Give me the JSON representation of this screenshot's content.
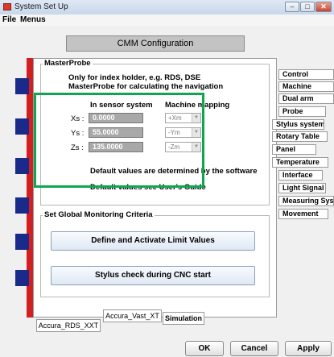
{
  "window": {
    "title": "System Set Up",
    "minimize": "–",
    "maximize": "□",
    "close": "✕"
  },
  "menu": {
    "file": "File",
    "menus": "Menus"
  },
  "header": {
    "title": "CMM Configuration"
  },
  "masterprobe": {
    "group_label": "MasterProbe",
    "info_line1": "Only for index holder, e.g. RDS, DSE",
    "info_line2": "MasterProbe for calculating the navigation",
    "col_sensor": "In sensor system",
    "col_machine": "Machine mapping",
    "rows": [
      {
        "label": "Xs :",
        "value": "0.0000",
        "mapping": "+Xm"
      },
      {
        "label": "Ys :",
        "value": "55.0000",
        "mapping": "-Ym"
      },
      {
        "label": "Zs :",
        "value": "135.0000",
        "mapping": "-Zm"
      }
    ],
    "default_note": "Default values are determined by the software",
    "user_guide_note": "Default values see User's Guide"
  },
  "monitoring": {
    "group_label": "Set Global Monitoring Criteria",
    "limit_button": "Define and Activate Limit Values",
    "stylus_button": "Stylus check during CNC start"
  },
  "side_tabs": [
    "Control",
    "Machine",
    "Dual arm",
    "Probe",
    "Stylus system",
    "Rotary Table",
    "Panel",
    "Temperature",
    "Interface",
    "Light Signal",
    "Measuring Sys",
    "Movement"
  ],
  "bottom_tabs": {
    "rds": "Accura_RDS_XXT",
    "vast": "Accura_Vast_XT",
    "simulation": "Simulation"
  },
  "buttons": {
    "ok": "OK",
    "cancel": "Cancel",
    "apply": "Apply"
  },
  "colors": {
    "highlight": "#10a550",
    "accent_red": "#d21f1f",
    "accent_blue": "#1a2a8a"
  }
}
